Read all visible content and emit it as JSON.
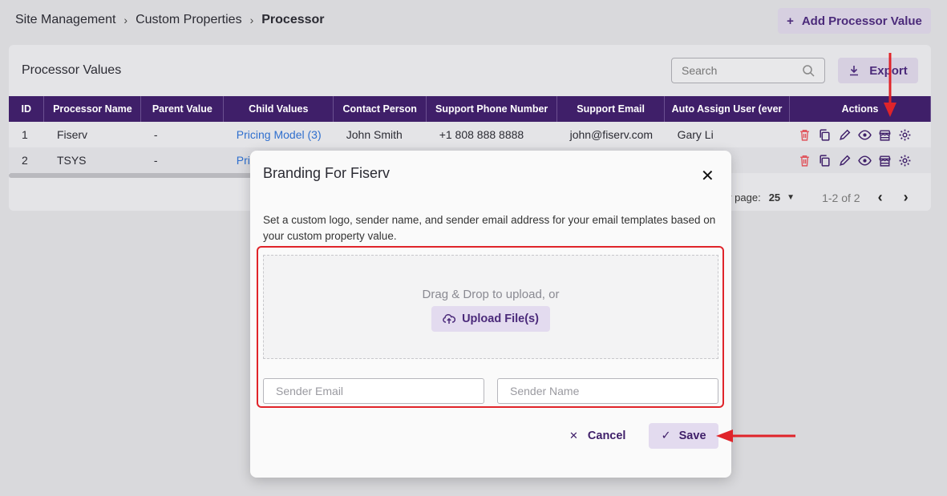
{
  "breadcrumb": {
    "item1": "Site Management",
    "item2": "Custom Properties",
    "item3": "Processor",
    "sep": ">"
  },
  "header": {
    "add_button": "Add Processor Value",
    "add_icon": "+"
  },
  "card": {
    "title": "Processor Values",
    "search_placeholder": "Search",
    "export_label": "Export"
  },
  "table": {
    "columns": [
      "ID",
      "Processor Name",
      "Parent Value",
      "Child Values",
      "Contact Person",
      "Support Phone Number",
      "Support Email",
      "Auto Assign User (ever",
      "Actions"
    ],
    "rows": [
      {
        "id": "1",
        "name": "Fiserv",
        "parent": "-",
        "child": "Pricing Model (3)",
        "contact": "John Smith",
        "phone": "+1 808 888 8888",
        "email": "john@fiserv.com",
        "user": "Gary Li"
      },
      {
        "id": "2",
        "name": "TSYS",
        "parent": "-",
        "child": "Pri",
        "contact": "",
        "phone": "",
        "email": "",
        "user": ""
      }
    ]
  },
  "pager": {
    "per_page_label": "er page:",
    "per_page_value": "25",
    "range": "1-2 of 2"
  },
  "modal": {
    "title": "Branding For Fiserv",
    "close": "✕",
    "description": "Set a custom logo, sender name, and sender email address for your email templates based on your custom property value.",
    "drop_text": "Drag & Drop to upload, or",
    "upload_label": "Upload File(s)",
    "sender_email_placeholder": "Sender Email",
    "sender_name_placeholder": "Sender Name",
    "cancel_label": "Cancel",
    "save_label": "Save"
  },
  "colors": {
    "primary": "#3f1f69",
    "accent_bg": "#d6cfe0",
    "link": "#2f6fce",
    "delete": "#e0525a",
    "annotation": "#e0242a"
  }
}
